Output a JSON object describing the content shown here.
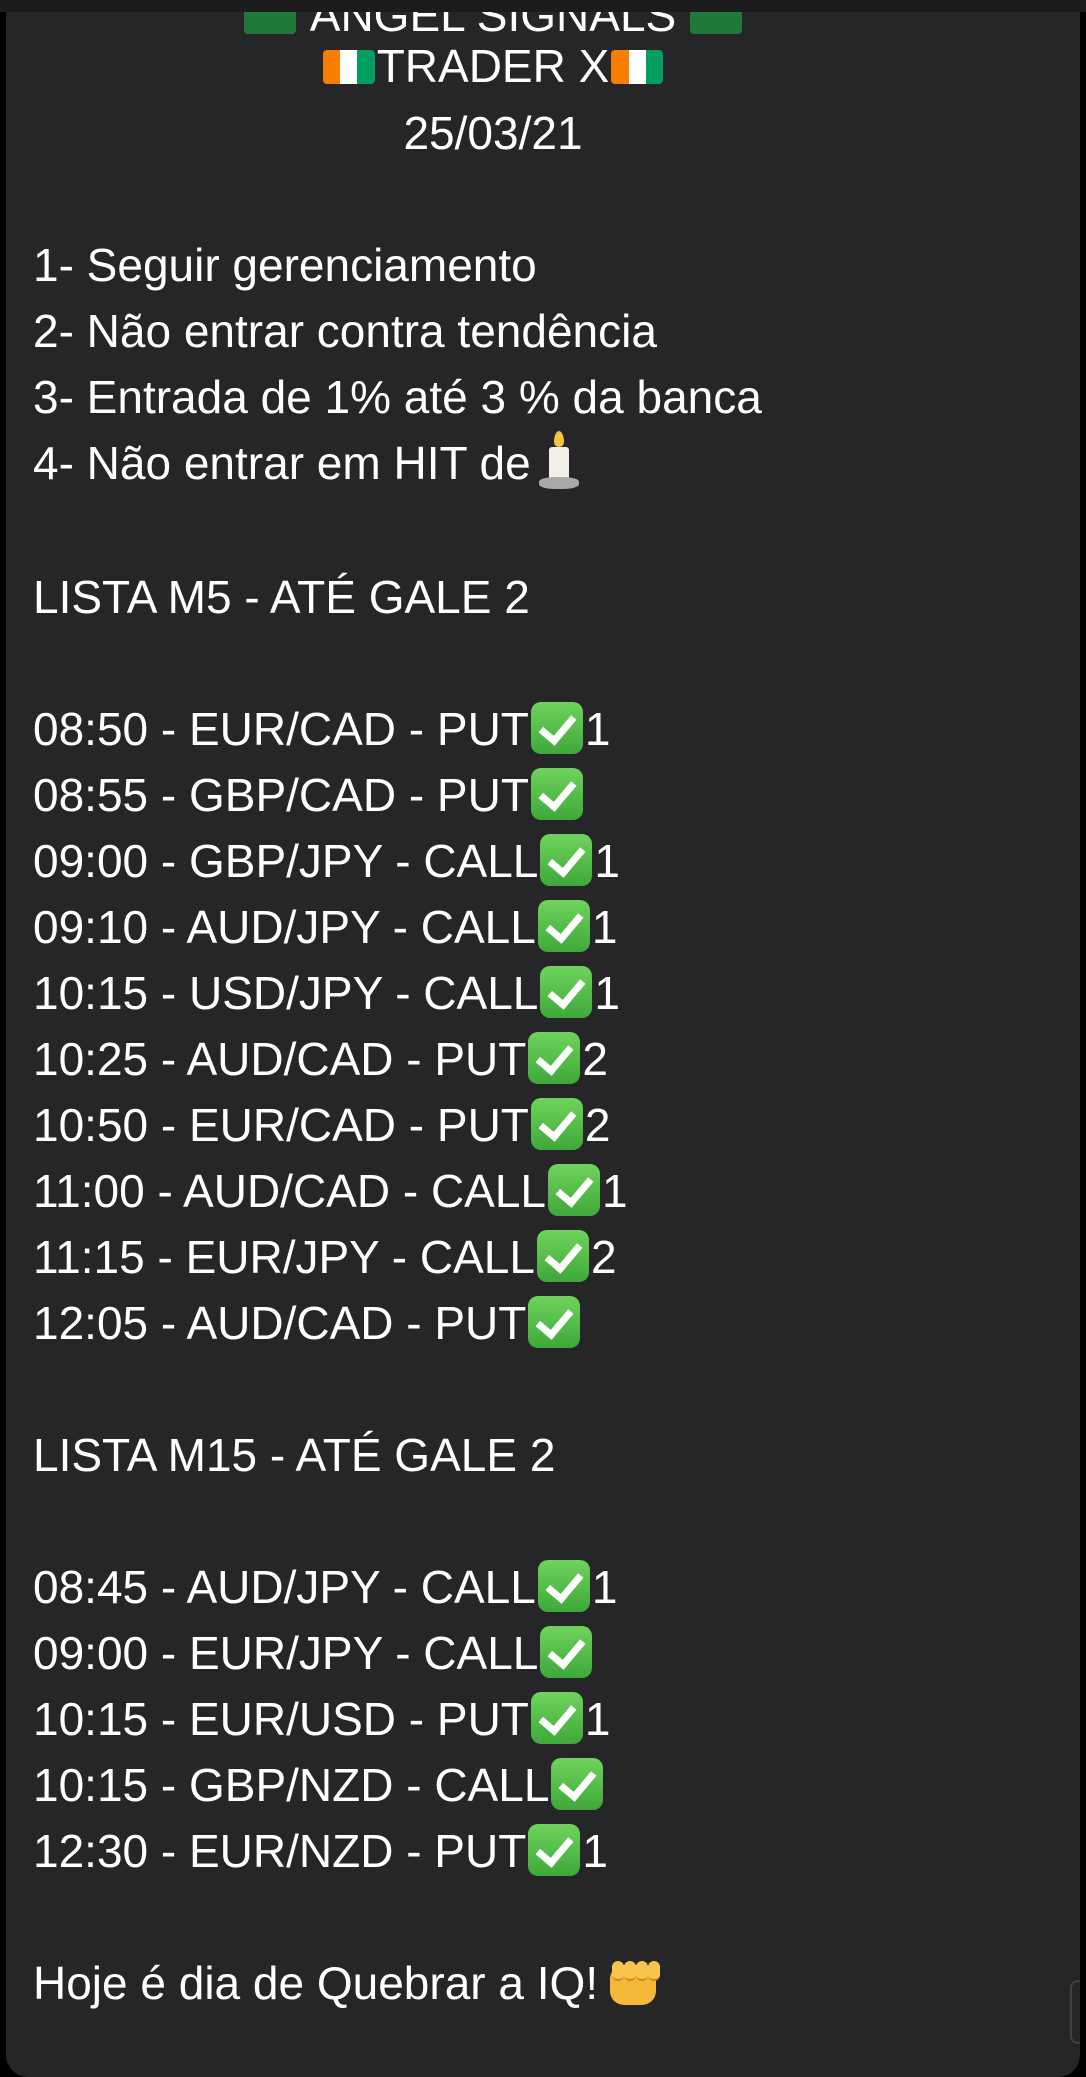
{
  "message": {
    "header_cut": "ANGEL SIGNALS",
    "title": "TRADER X",
    "date": "25/03/21",
    "rules": [
      "1- Seguir gerenciamento",
      "2- Não entrar contra tendência",
      "3- Entrada de 1% até 3 % da banca",
      "4- Não entrar em HIT de"
    ],
    "list_m5_title": "LISTA M5 - ATÉ GALE 2",
    "list_m5": [
      {
        "text": "08:50 - EUR/CAD - PUT",
        "suffix": "1"
      },
      {
        "text": "08:55 - GBP/CAD - PUT",
        "suffix": ""
      },
      {
        "text": "09:00 - GBP/JPY - CALL",
        "suffix": "1"
      },
      {
        "text": "09:10 - AUD/JPY - CALL",
        "suffix": "1"
      },
      {
        "text": "10:15 - USD/JPY - CALL",
        "suffix": "1"
      },
      {
        "text": "10:25 - AUD/CAD - PUT",
        "suffix": "2"
      },
      {
        "text": "10:50 - EUR/CAD - PUT",
        "suffix": "2"
      },
      {
        "text": "11:00 - AUD/CAD - CALL",
        "suffix": "1"
      },
      {
        "text": "11:15 - EUR/JPY - CALL",
        "suffix": "2"
      },
      {
        "text": "12:05 - AUD/CAD - PUT",
        "suffix": ""
      }
    ],
    "list_m15_title": "LISTA M15 - ATÉ GALE 2",
    "list_m15": [
      {
        "text": "08:45 - AUD/JPY - CALL",
        "suffix": "1"
      },
      {
        "text": "09:00 - EUR/JPY - CALL",
        "suffix": ""
      },
      {
        "text": "10:15 - EUR/USD - PUT",
        "suffix": "1"
      },
      {
        "text": "10:15 - GBP/NZD - CALL",
        "suffix": ""
      },
      {
        "text": "12:30 - EUR/NZD - PUT",
        "suffix": "1"
      }
    ],
    "closing": "Hoje é dia de Quebrar a IQ!"
  },
  "icons": {
    "header_flag": "green-flag-icon",
    "title_flag": "ivory-coast-flag-icon",
    "check": "check-mark-button-icon",
    "candle": "candle-icon",
    "fist": "oncoming-fist-icon"
  },
  "colors": {
    "background": "#000000",
    "bubble": "#262628",
    "text": "#ffffff",
    "check_green": "#4cbb3e"
  }
}
